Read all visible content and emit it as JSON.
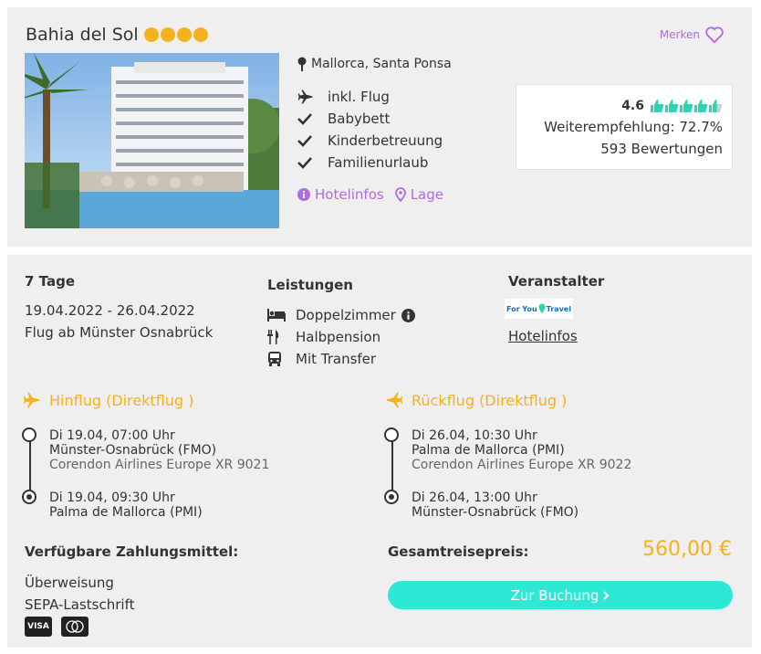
{
  "hotel": {
    "name": "Bahia del Sol",
    "stars": 4,
    "save_label": "Merken",
    "location": "Mallorca, Santa Ponsa",
    "features": [
      "inkl. Flug",
      "Babybett",
      "Kinderbetreuung",
      "Familienurlaub"
    ],
    "link_infos": "Hotelinfos",
    "link_location": "Lage"
  },
  "rating": {
    "score": "4.6",
    "thumbs": 4.6,
    "recommendation": "Weiterempfehlung: 72.7%",
    "reviews": "593 Bewertungen"
  },
  "trip": {
    "duration": "7 Tage",
    "date_range": "19.04.2022 - 26.04.2022",
    "departure": "Flug ab Münster Osnabrück"
  },
  "services": {
    "title": "Leistungen",
    "items": [
      "Doppelzimmer",
      "Halbpension",
      "Mit Transfer"
    ]
  },
  "operator": {
    "title": "Veranstalter",
    "logo_text_1": "For You",
    "logo_text_2": "Travel",
    "link": "Hotelinfos"
  },
  "outbound": {
    "title": "Hinflug (Direktflug )",
    "dep_time": "Di 19.04, 07:00 Uhr",
    "dep_airport": "Münster-Osnabrück (FMO)",
    "airline": "Corendon Airlines Europe XR 9021",
    "arr_time": "Di 19.04, 09:30 Uhr",
    "arr_airport": "Palma de Mallorca (PMI)"
  },
  "return": {
    "title": "Rückflug (Direktflug )",
    "dep_time": "Di 26.04, 10:30 Uhr",
    "dep_airport": "Palma de Mallorca (PMI)",
    "airline": "Corendon Airlines Europe XR 9022",
    "arr_time": "Di 26.04, 13:00 Uhr",
    "arr_airport": "Münster-Osnabrück (FMO)"
  },
  "payment": {
    "title": "Verfügbare Zahlungsmittel:",
    "methods": [
      "Überweisung",
      "SEPA-Lastschrift"
    ],
    "visa_label": "VISA"
  },
  "total": {
    "title": "Gesamtreisepreis:",
    "price": "560,00 €",
    "button": "Zur Buchung"
  },
  "colors": {
    "accent_orange": "#f6b21b",
    "accent_purple": "#b36be0",
    "accent_teal": "#2ee8d6",
    "rating_green": "#2ed3b0"
  }
}
